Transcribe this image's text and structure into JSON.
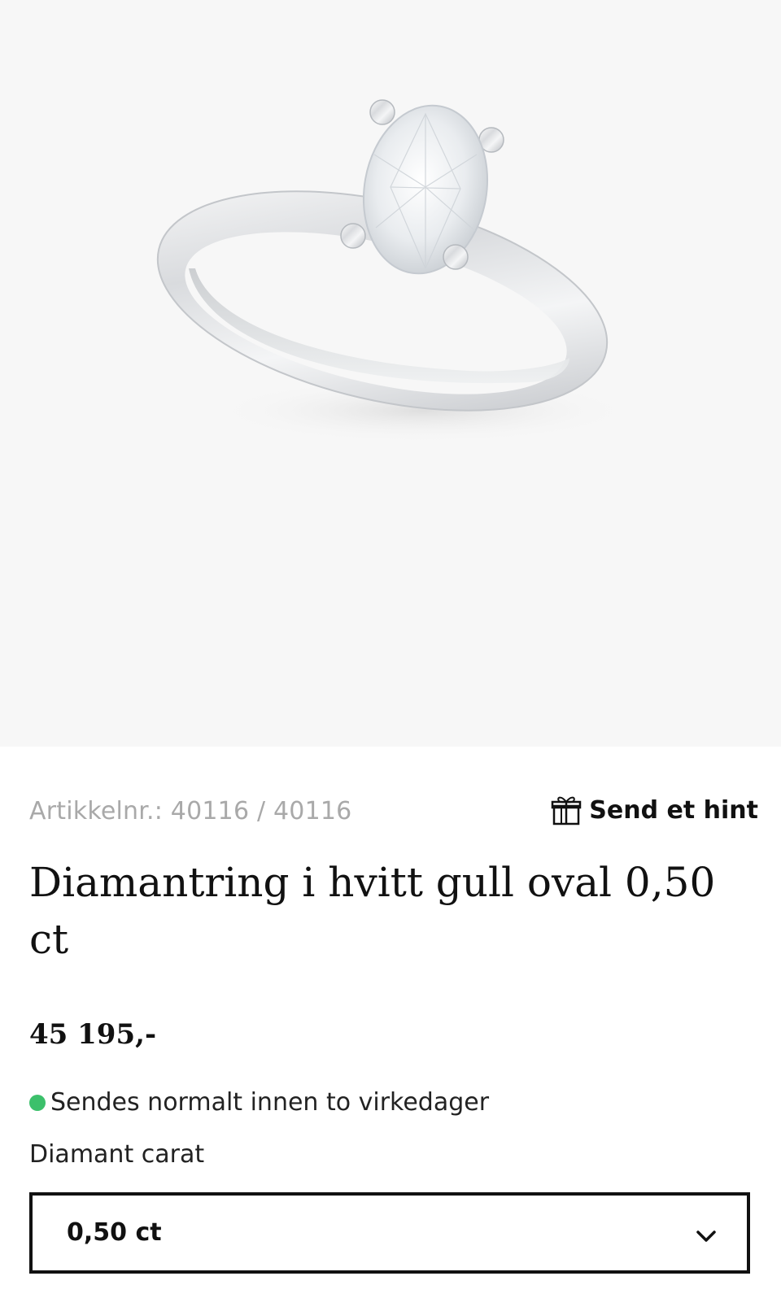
{
  "product": {
    "image_alt": "Diamantring i hvitt gull oval 0,50 ct",
    "sku_label": "Artikkelnr.: 40116 / 40116",
    "hint_label": "Send et hint",
    "hint_icon": "gift-icon",
    "title": "Diamantring i hvitt gull oval 0,50 ct",
    "price": "45 195,-",
    "stock_status": "Sendes normalt innen to virkedager",
    "stock_color": "#3cc06b"
  },
  "variant": {
    "label": "Diamant carat",
    "selected": "0,50 ct",
    "chevron_icon": "chevron-down-icon"
  }
}
